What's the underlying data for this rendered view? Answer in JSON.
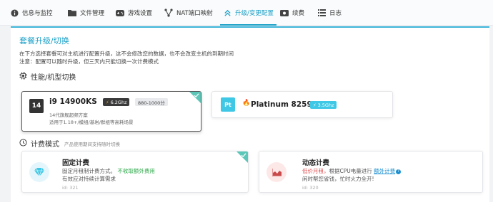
{
  "tabs": [
    {
      "label": "信息与监控",
      "icon": "info-icon"
    },
    {
      "label": "文件管理",
      "icon": "folder-icon"
    },
    {
      "label": "游戏设置",
      "icon": "gamepad-icon"
    },
    {
      "label": "NAT端口映射",
      "icon": "network-icon"
    },
    {
      "label": "升级/变更配置",
      "icon": "double-chevron-up-icon",
      "active": true
    },
    {
      "label": "续费",
      "icon": "ticket-icon"
    },
    {
      "label": "日志",
      "icon": "list-icon"
    }
  ],
  "page": {
    "title": "套餐升级/切换",
    "desc_line1": "在下方选择套餐可对主机进行配置升级，这不会修改您的数据，也不会改变主机的到期时间",
    "desc_line2": "注意：配置可以随时升级，但三天内只能切换一次计费模式"
  },
  "performance_section": {
    "title": "性能/机型切换",
    "icon": "cpu-icon"
  },
  "cpu_options": [
    {
      "chip": "14",
      "name": "i9 14900KS",
      "freq": "6.2Ghz",
      "score": "880-1000分",
      "line1": "14代旗舰超频方案",
      "line2": "适用于1.18+/模组/基岩/群组等高耗场景",
      "selected": true
    },
    {
      "chip": "Pt",
      "name": "Platinum 8259cl",
      "freq": "3.5Ghz",
      "selected": false
    }
  ],
  "billing_section": {
    "title": "计费模式",
    "subtitle": "产品使用期间支持随时切换"
  },
  "billing_options": [
    {
      "title": "固定计费",
      "line1_prefix": "固定月租制计费方式。",
      "line1_highlight": "不收取额外费用",
      "line2": "有效应对持续计算需求",
      "id": "id: 321",
      "icon": "gem-icon",
      "selected": true
    },
    {
      "title": "动态计费",
      "line1_prefix": "低价月租，",
      "line1_mid": "根据CPU电量进行",
      "line1_link": "额外计费",
      "line2": "闲时帮您省钱，忙时火力全开!",
      "id": "id: 320",
      "icon": "chart-icon",
      "selected": false
    }
  ],
  "colors": {
    "accent": "#1aa0c8",
    "corner_check": "#5cc6b8",
    "highlight_green": "#2eaa4a",
    "highlight_red": "#e05050",
    "link": "#1a8fd0"
  }
}
